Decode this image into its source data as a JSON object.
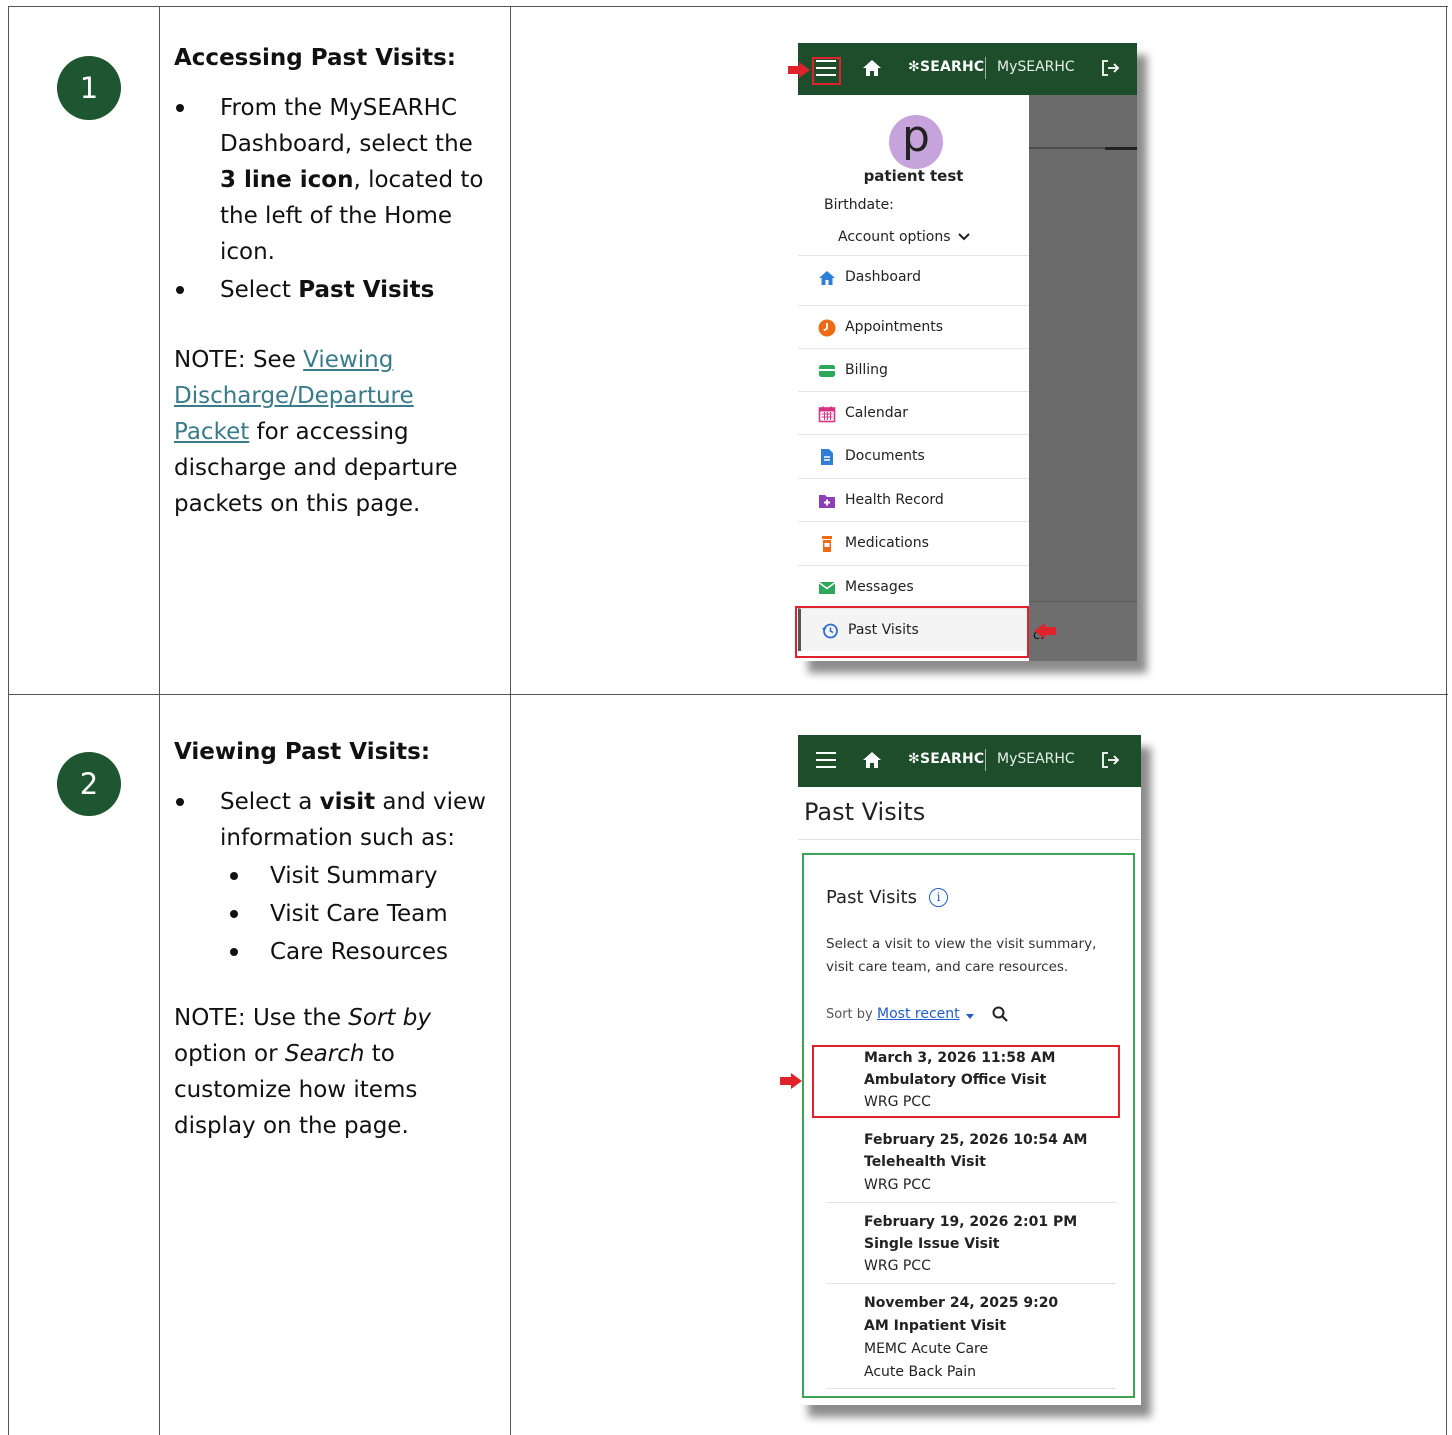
{
  "steps": [
    {
      "number": "1",
      "title": "Accessing Past Visits",
      "bullets": {
        "b1_pre": "From the MySEARHC Dashboard, select the ",
        "b1_bold": "3 line icon",
        "b1_post": ", located to the left of the Home icon.",
        "b2_pre": "Select ",
        "b2_bold": "Past Visits"
      },
      "note": {
        "pre": "NOTE: See ",
        "link": "Viewing Discharge/Departure Packet",
        "post": " for accessing discharge and departure packets on this page."
      }
    },
    {
      "number": "2",
      "title": "Viewing Past Visits",
      "bullets": {
        "b1_pre": "Select a ",
        "b1_bold": "visit",
        "b1_post": " and view information such as:"
      },
      "sub_bullets": [
        "Visit Summary",
        "Visit Care Team",
        "Care Resources"
      ],
      "note": {
        "p1": "NOTE: Use the ",
        "i1": "Sort by",
        "p2": " option or ",
        "i2": "Search",
        "p3": " to customize how items display on the page."
      }
    }
  ],
  "app": {
    "brand": "SEARHC",
    "app_name": "MySEARHC",
    "colors": {
      "header": "#1e4d2b",
      "badge": "#1e5631",
      "highlight_red": "#e0232a",
      "highlight_green": "#3ba555",
      "link": "#1f5ec9"
    }
  },
  "menu_screen": {
    "avatar_letter": "p",
    "patient_name": "patient test",
    "birthdate_label": "Birthdate:",
    "account_options": "Account options",
    "items": [
      {
        "label": "Dashboard",
        "icon": "home-icon"
      },
      {
        "label": "Appointments",
        "icon": "clock-icon"
      },
      {
        "label": "Billing",
        "icon": "wallet-icon"
      },
      {
        "label": "Calendar",
        "icon": "calendar-icon"
      },
      {
        "label": "Documents",
        "icon": "document-icon"
      },
      {
        "label": "Health Record",
        "icon": "health-record-icon"
      },
      {
        "label": "Medications",
        "icon": "pill-bottle-icon"
      },
      {
        "label": "Messages",
        "icon": "envelope-icon"
      },
      {
        "label": "Past Visits",
        "icon": "history-icon"
      }
    ],
    "footer_fragment": "c."
  },
  "past_visits_screen": {
    "page_title": "Past Visits",
    "section_title": "Past Visits",
    "description": "Select a visit to view the visit summary, visit care team, and care resources.",
    "sort_label": "Sort by",
    "sort_value": "Most recent",
    "visits": [
      {
        "date": "March 3, 2026 11:58 AM",
        "type": "Ambulatory Office Visit",
        "location": "WRG PCC"
      },
      {
        "date": "February 25, 2026 10:54 AM",
        "type": "Telehealth Visit",
        "location": "WRG PCC"
      },
      {
        "date": "February 19, 2026  2:01 PM",
        "type": "Single Issue Visit",
        "location": "WRG PCC"
      },
      {
        "date": "November 24, 2025 9:20",
        "type": "AM Inpatient Visit",
        "location": "MEMC Acute Care",
        "reason": "Acute Back Pain"
      }
    ]
  }
}
